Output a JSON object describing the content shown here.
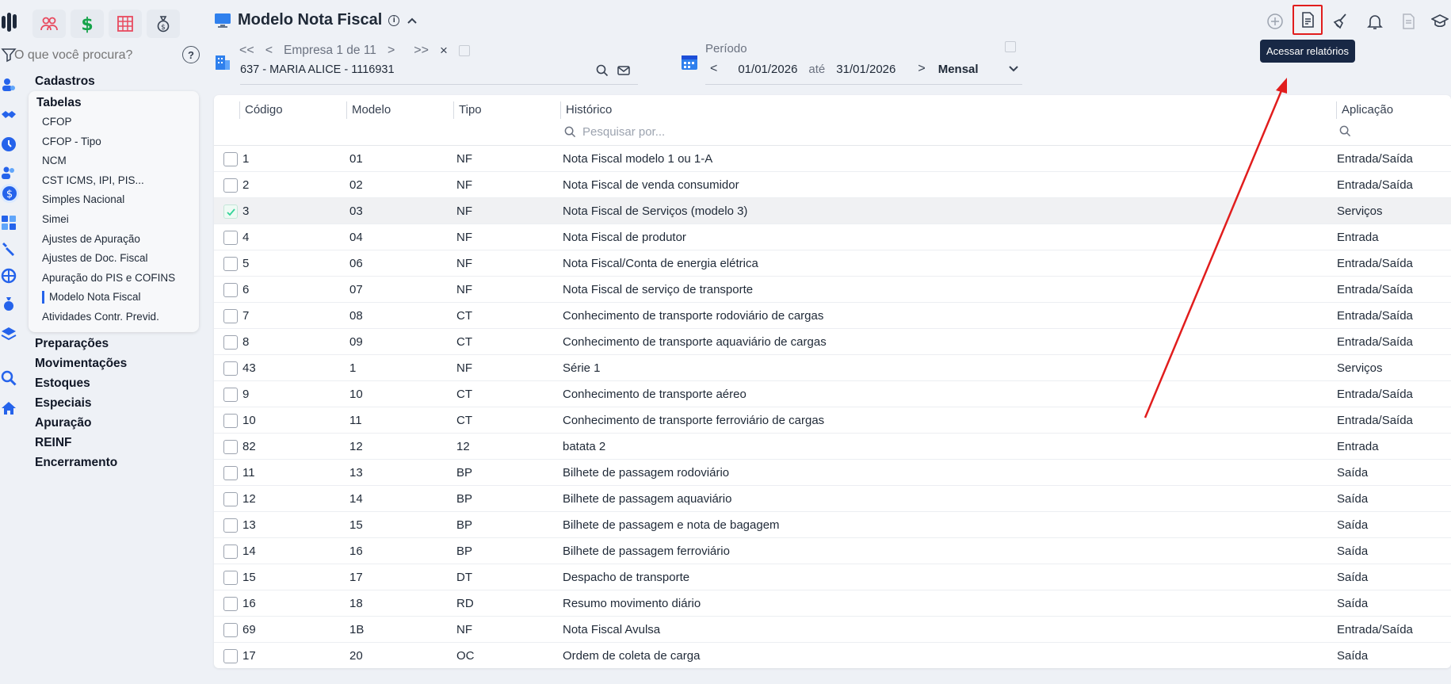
{
  "colors": {
    "accent": "#2563eb",
    "annotation": "#e11d1d",
    "tooltip_bg": "#182845"
  },
  "search": {
    "placeholder": "O que você procura?",
    "help": "?"
  },
  "nav": {
    "sections_before": [
      "Cadastros"
    ],
    "open_section": "Tabelas",
    "items": [
      "CFOP",
      "CFOP - Tipo",
      "NCM",
      "CST ICMS, IPI, PIS...",
      "Simples Nacional",
      "Simei",
      "Ajustes de Apuração",
      "Ajustes de Doc. Fiscal",
      "Apuração do PIS e COFINS",
      "Modelo Nota Fiscal",
      "Atividades Contr. Previd."
    ],
    "active_item": "Modelo Nota Fiscal",
    "sections_after": [
      "Preparações",
      "Movimentações",
      "Estoques",
      "Especiais",
      "Apuração",
      "REINF",
      "Encerramento"
    ]
  },
  "header": {
    "title": "Modelo Nota Fiscal",
    "info": "i"
  },
  "empresa": {
    "label": "Empresa 1 de 11",
    "first": "<<",
    "prev": "<",
    "next": ">",
    "last": ">>",
    "clear": "×",
    "name": "637 - MARIA ALICE - 1116931"
  },
  "periodo": {
    "label": "Período",
    "prev": "<",
    "next": ">",
    "start": "01/01/2026",
    "sep": "até",
    "end": "31/01/2026",
    "mode": "Mensal"
  },
  "actions": {
    "icons": [
      "plus-circle-icon",
      "report-icon",
      "broom-icon",
      "bell-icon",
      "document-icon",
      "graduation-cap-icon"
    ],
    "tooltip": "Acessar relatórios"
  },
  "table": {
    "columns": {
      "codigo": "Código",
      "modelo": "Modelo",
      "tipo": "Tipo",
      "historico": "Histórico",
      "aplicacao": "Aplicação"
    },
    "filter_placeholder": "Pesquisar por...",
    "rows": [
      {
        "codigo": "1",
        "modelo": "01",
        "tipo": "NF",
        "historico": "Nota Fiscal modelo 1 ou 1-A",
        "aplicacao": "Entrada/Saída",
        "checked": false
      },
      {
        "codigo": "2",
        "modelo": "02",
        "tipo": "NF",
        "historico": "Nota Fiscal de venda consumidor",
        "aplicacao": "Entrada/Saída",
        "checked": false
      },
      {
        "codigo": "3",
        "modelo": "03",
        "tipo": "NF",
        "historico": "Nota Fiscal de Serviços (modelo 3)",
        "aplicacao": "Serviços",
        "checked": true
      },
      {
        "codigo": "4",
        "modelo": "04",
        "tipo": "NF",
        "historico": "Nota Fiscal de produtor",
        "aplicacao": "Entrada",
        "checked": false
      },
      {
        "codigo": "5",
        "modelo": "06",
        "tipo": "NF",
        "historico": "Nota Fiscal/Conta de energia elétrica",
        "aplicacao": "Entrada/Saída",
        "checked": false
      },
      {
        "codigo": "6",
        "modelo": "07",
        "tipo": "NF",
        "historico": "Nota Fiscal de serviço de transporte",
        "aplicacao": "Entrada/Saída",
        "checked": false
      },
      {
        "codigo": "7",
        "modelo": "08",
        "tipo": "CT",
        "historico": "Conhecimento de transporte rodoviário de cargas",
        "aplicacao": "Entrada/Saída",
        "checked": false
      },
      {
        "codigo": "8",
        "modelo": "09",
        "tipo": "CT",
        "historico": "Conhecimento de transporte aquaviário de cargas",
        "aplicacao": "Entrada/Saída",
        "checked": false
      },
      {
        "codigo": "43",
        "modelo": "1",
        "tipo": "NF",
        "historico": "Série 1",
        "aplicacao": "Serviços",
        "checked": false
      },
      {
        "codigo": "9",
        "modelo": "10",
        "tipo": "CT",
        "historico": "Conhecimento de transporte aéreo",
        "aplicacao": "Entrada/Saída",
        "checked": false
      },
      {
        "codigo": "10",
        "modelo": "11",
        "tipo": "CT",
        "historico": "Conhecimento de transporte ferroviário de cargas",
        "aplicacao": "Entrada/Saída",
        "checked": false
      },
      {
        "codigo": "82",
        "modelo": "12",
        "tipo": "12",
        "historico": "batata 2",
        "aplicacao": "Entrada",
        "checked": false
      },
      {
        "codigo": "11",
        "modelo": "13",
        "tipo": "BP",
        "historico": "Bilhete de passagem rodoviário",
        "aplicacao": "Saída",
        "checked": false
      },
      {
        "codigo": "12",
        "modelo": "14",
        "tipo": "BP",
        "historico": "Bilhete de passagem aquaviário",
        "aplicacao": "Saída",
        "checked": false
      },
      {
        "codigo": "13",
        "modelo": "15",
        "tipo": "BP",
        "historico": "Bilhete de passagem e nota de bagagem",
        "aplicacao": "Saída",
        "checked": false
      },
      {
        "codigo": "14",
        "modelo": "16",
        "tipo": "BP",
        "historico": "Bilhete de passagem ferroviário",
        "aplicacao": "Saída",
        "checked": false
      },
      {
        "codigo": "15",
        "modelo": "17",
        "tipo": "DT",
        "historico": "Despacho de transporte",
        "aplicacao": "Saída",
        "checked": false
      },
      {
        "codigo": "16",
        "modelo": "18",
        "tipo": "RD",
        "historico": "Resumo movimento diário",
        "aplicacao": "Saída",
        "checked": false
      },
      {
        "codigo": "69",
        "modelo": "1B",
        "tipo": "NF",
        "historico": "Nota Fiscal Avulsa",
        "aplicacao": "Entrada/Saída",
        "checked": false
      },
      {
        "codigo": "17",
        "modelo": "20",
        "tipo": "OC",
        "historico": "Ordem de coleta de carga",
        "aplicacao": "Saída",
        "checked": false
      }
    ]
  }
}
